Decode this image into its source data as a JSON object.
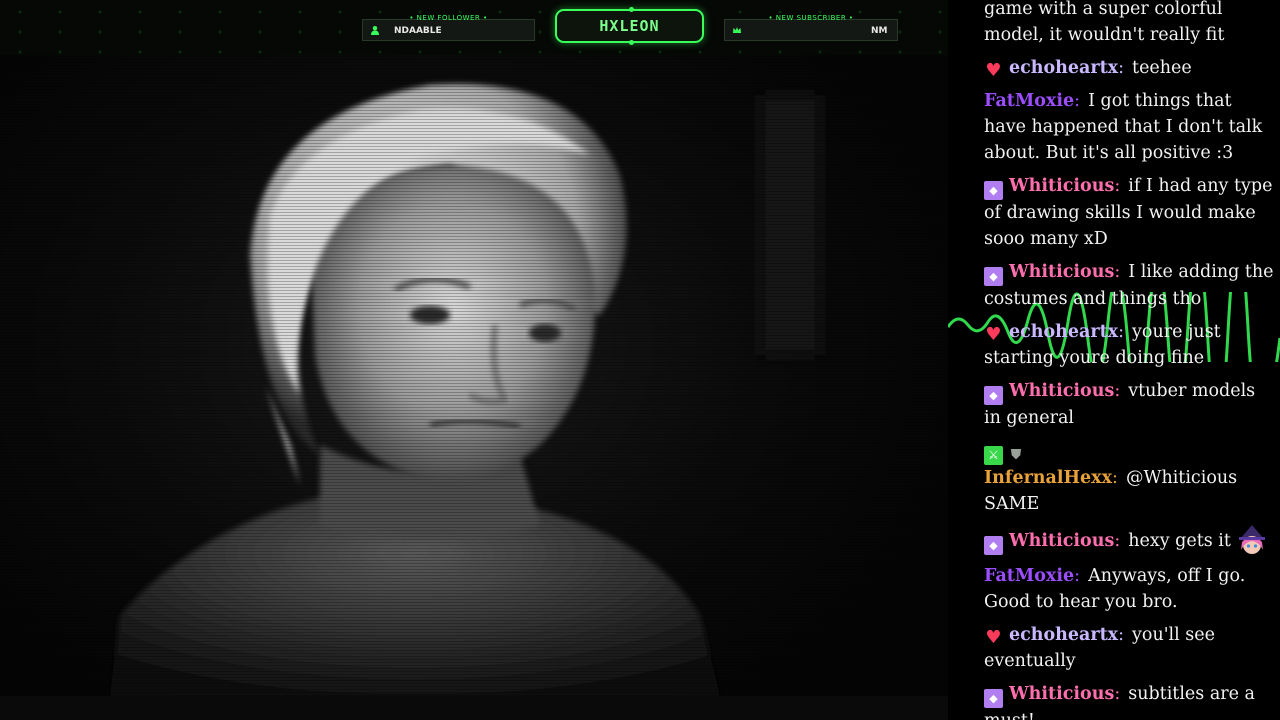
{
  "overlay": {
    "logo_text": "HXLEON",
    "follower": {
      "title": "• NEW FOLLOWER •",
      "name": "NDAABLE",
      "icon": "user-icon"
    },
    "subscriber": {
      "title": "• NEW SUBSCRIBER •",
      "name": "NM",
      "icon": "crown-icon"
    },
    "accent_color": "#39ff5a"
  },
  "chat": {
    "partial_line_1": "game with a super colorful",
    "partial_line_2": "model, it wouldn't really fit",
    "messages": [
      {
        "badges": [
          "heart"
        ],
        "user": "echoheartx",
        "color": "#c9b8ff",
        "text": "teehee"
      },
      {
        "badges": [],
        "user": "FatMoxie",
        "color": "#9b4dff",
        "text": "I got things that have happened that I don't talk about. But it's all positive :3"
      },
      {
        "badges": [
          "diamond"
        ],
        "user": "Whiticious",
        "color": "#ff6fae",
        "text": "if I had any type of drawing skills I would make sooo many xD"
      },
      {
        "badges": [
          "diamond"
        ],
        "user": "Whiticious",
        "color": "#ff6fae",
        "text": "I like adding the costumes and things tho"
      },
      {
        "badges": [
          "heart"
        ],
        "user": "echoheartx",
        "color": "#c9b8ff",
        "text": "youre just starting youre doing fine"
      },
      {
        "badges": [
          "diamond"
        ],
        "user": "Whiticious",
        "color": "#ff6fae",
        "text": "vtuber models in general"
      },
      {
        "badges": [
          "sword",
          "shield"
        ],
        "user": "InfernalHexx",
        "color": "#e8a23a",
        "text": "@Whiticious SAME"
      },
      {
        "badges": [
          "diamond"
        ],
        "user": "Whiticious",
        "color": "#ff6fae",
        "text": "hexy gets it",
        "emote": "witch-emote"
      },
      {
        "badges": [],
        "user": "FatMoxie",
        "color": "#9b4dff",
        "text": "Anyways, off I go. Good to hear you bro."
      },
      {
        "badges": [
          "heart"
        ],
        "user": "echoheartx",
        "color": "#c9b8ff",
        "text": "you'll see eventually"
      },
      {
        "badges": [
          "diamond"
        ],
        "user": "Whiticious",
        "color": "#ff6fae",
        "text": "subtitles are a must!"
      }
    ]
  }
}
